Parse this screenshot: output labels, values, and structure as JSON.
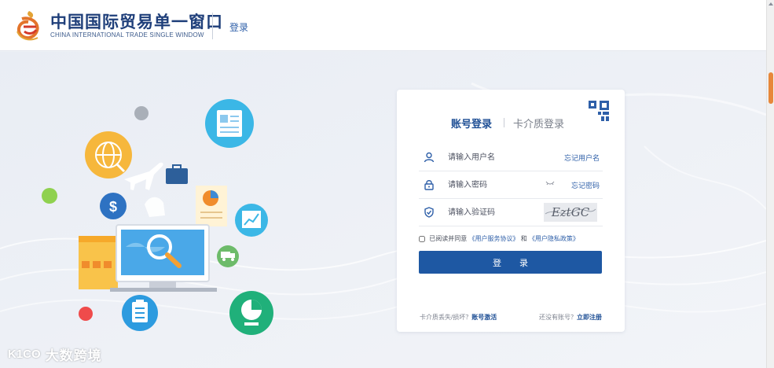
{
  "header": {
    "logo_cn": "中国国际贸易单一窗口",
    "logo_en": "CHINA INTERNATIONAL TRADE SINGLE WINDOW",
    "login_link": "登录"
  },
  "login_card": {
    "tabs": [
      {
        "label": "账号登录",
        "active": true
      },
      {
        "label": "卡介质登录",
        "active": false
      }
    ],
    "fields": {
      "username": {
        "placeholder": "请输入用户名",
        "link": "忘记用户名",
        "icon": "user-icon"
      },
      "password": {
        "placeholder": "请输入密码",
        "link": "忘记密码",
        "icon": "lock-icon"
      },
      "captcha": {
        "placeholder": "请输入验证码",
        "icon": "shield-check-icon",
        "captcha_text": "EztGC"
      }
    },
    "agreement": {
      "prefix": "已阅读并同意",
      "service": "《用户服务协议》",
      "and": "和",
      "privacy": "《用户隐私政策》"
    },
    "submit_label": "登 录",
    "bottom": {
      "lost_text": "卡介质丢失/损坏？",
      "lost_link": "账号激活",
      "register_text": "还没有账号？",
      "register_link": "立即注册"
    }
  },
  "watermark": {
    "mark": "K1CO",
    "text": "大数跨境"
  },
  "colors": {
    "brand_blue": "#1e58a3",
    "link_blue": "#2e5fa8",
    "scroll_thumb": "#e7883b",
    "logo_orange": "#e3742b",
    "logo_red": "#d43a2a"
  }
}
